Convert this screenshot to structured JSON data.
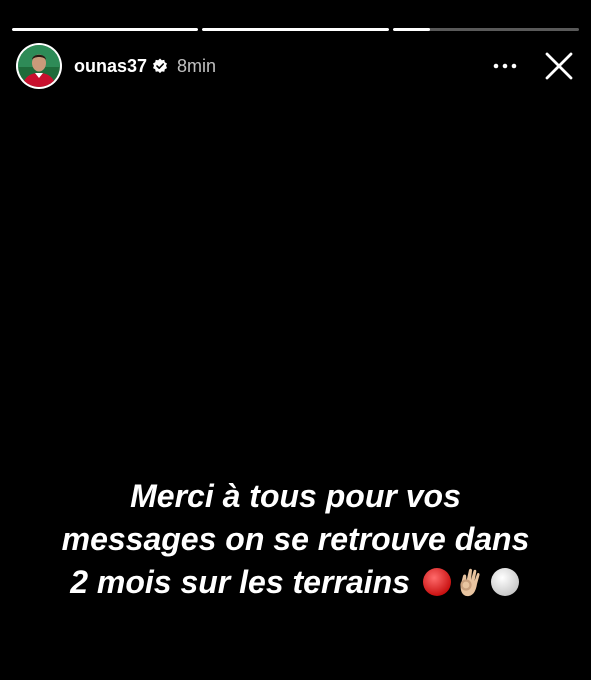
{
  "story": {
    "progress": [
      1,
      1,
      0.2
    ],
    "username": "ounas37",
    "verified": true,
    "time_ago": "8min",
    "caption_lines": [
      "Merci à tous pour vos",
      "messages on se retrouve dans",
      "2 mois sur les terrains"
    ],
    "caption_emojis": [
      "red-circle-icon",
      "ok-hand-icon",
      "white-circle-icon"
    ]
  },
  "colors": {
    "background": "#000000",
    "text": "#ffffff",
    "avatar_jersey": "#c8102e"
  },
  "icons": {
    "more": "more-horizontal-icon",
    "close": "close-icon",
    "verified": "verified-badge-icon"
  }
}
